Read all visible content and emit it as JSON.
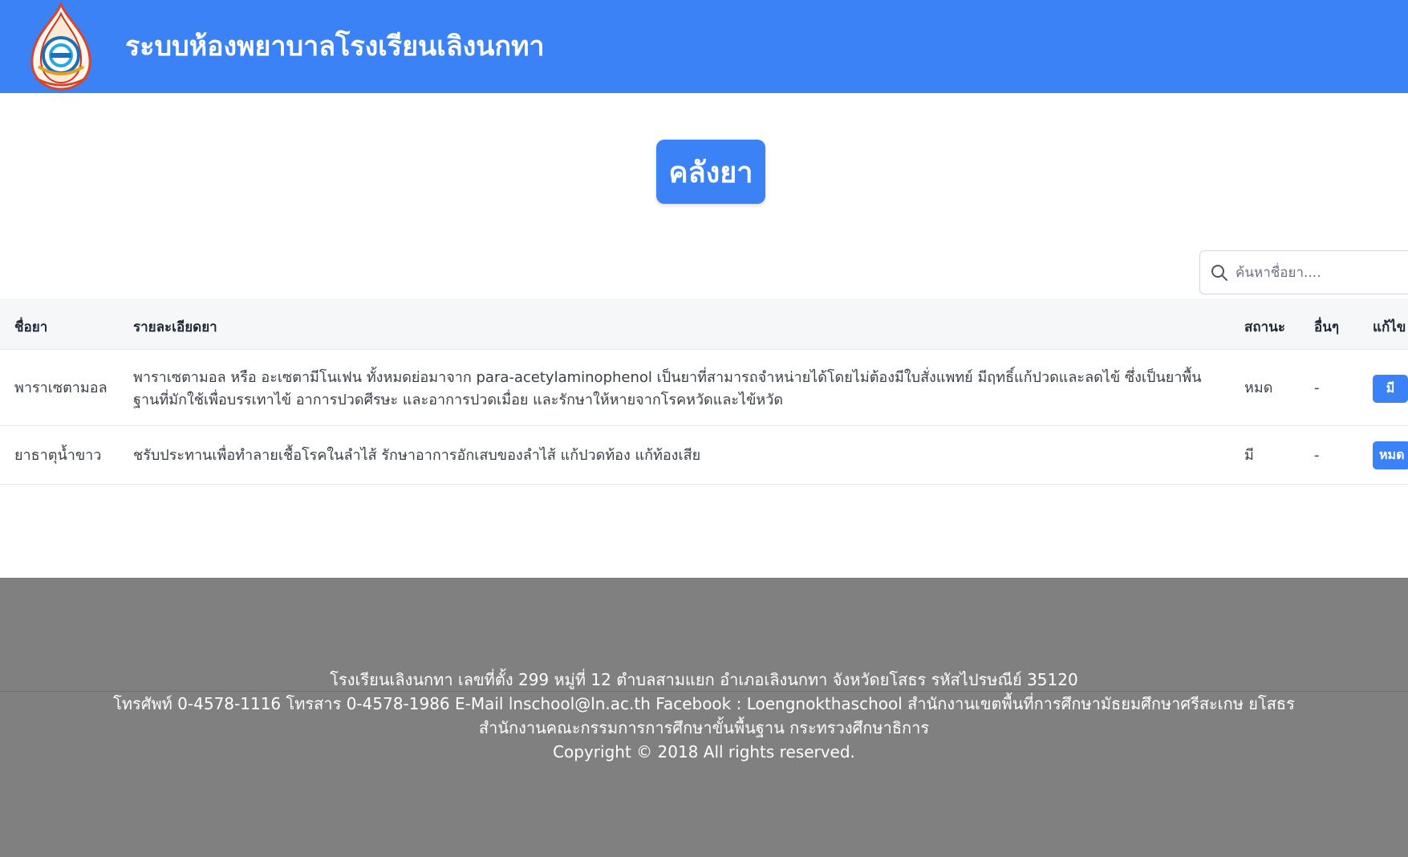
{
  "header": {
    "title": "ระบบห้องพยาบาลโรงเรียนเลิงนกทา",
    "logo": "school-emblem"
  },
  "page": {
    "title": "คลังยา"
  },
  "search": {
    "placeholder": "ค้นหาชื่อยา...."
  },
  "table": {
    "headers": {
      "name": "ชื่อยา",
      "desc": "รายละเอียดยา",
      "status": "สถานะ",
      "other": "อื่นๆ",
      "edit": "แก้ไข"
    },
    "rows": [
      {
        "name": "พาราเซตามอล",
        "desc": "พาราเซตามอล หรือ อะเซตามีโนเฟน ทั้งหมดย่อมาจาก para-acetylaminophenol เป็นยาที่สามารถจำหน่ายได้โดยไม่ต้องมีใบสั่งแพทย์ มีฤทธิ์แก้ปวดและลดไข้ ซึ่งเป็นยาพื้นฐานที่มักใช้เพื่อบรรเทาไข้ อาการปวดศีรษะ และอาการปวดเมื่อย และรักษาให้หายจากโรคหวัดและไข้หวัด",
        "status": "หมด",
        "other": "-",
        "edit_label": "มี"
      },
      {
        "name": "ยาธาตุน้ำขาว",
        "desc": "ชรับประทานเพื่อทำลายเชื้อโรคในลำไส้ รักษาอาการอักเสบของลำไส้ แก้ปวดท้อง แก้ท้องเสีย",
        "status": "มี",
        "other": "-",
        "edit_label": "หมด"
      }
    ]
  },
  "footer": {
    "line1": "โรงเรียนเลิงนกทา เลขที่ตั้ง 299 หมู่ที่ 12 ตำบลสามแยก อำเภอเลิงนกทา จังหวัดยโสธร รหัสไปรษณีย์ 35120",
    "line2": "โทรศัพท์ 0-4578-1116 โทรสาร 0-4578-1986 E-Mail lnschool@ln.ac.th Facebook : Loengnokthaschool สำนักงานเขตพื้นที่การศึกษามัธยมศึกษาศรีสะเกษ ยโสธร",
    "line3": "สำนักงานคณะกรรมการการศึกษาขั้นพื้นฐาน กระทรวงศึกษาธิการ",
    "line4": "Copyright © 2018 All rights reserved."
  },
  "colors": {
    "primary": "#3b82f6",
    "footer": "#808080",
    "table_header_bg": "#f6f7f9"
  }
}
